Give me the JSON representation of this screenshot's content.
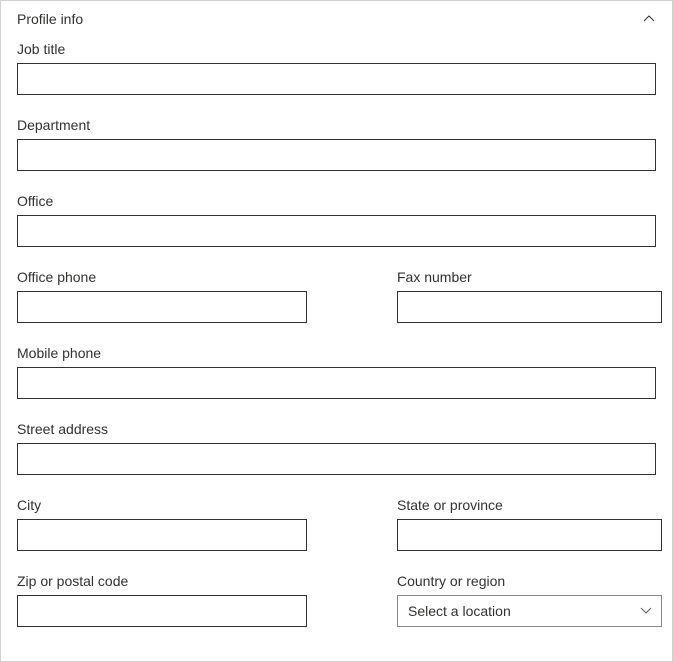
{
  "panel": {
    "title": "Profile info"
  },
  "fields": {
    "jobTitle": {
      "label": "Job title",
      "value": ""
    },
    "department": {
      "label": "Department",
      "value": ""
    },
    "office": {
      "label": "Office",
      "value": ""
    },
    "officePhone": {
      "label": "Office phone",
      "value": ""
    },
    "faxNumber": {
      "label": "Fax number",
      "value": ""
    },
    "mobilePhone": {
      "label": "Mobile phone",
      "value": ""
    },
    "streetAddress": {
      "label": "Street address",
      "value": ""
    },
    "city": {
      "label": "City",
      "value": ""
    },
    "stateProvince": {
      "label": "State or province",
      "value": ""
    },
    "zipPostal": {
      "label": "Zip or postal code",
      "value": ""
    },
    "countryRegion": {
      "label": "Country or region",
      "placeholder": "Select a location"
    }
  }
}
